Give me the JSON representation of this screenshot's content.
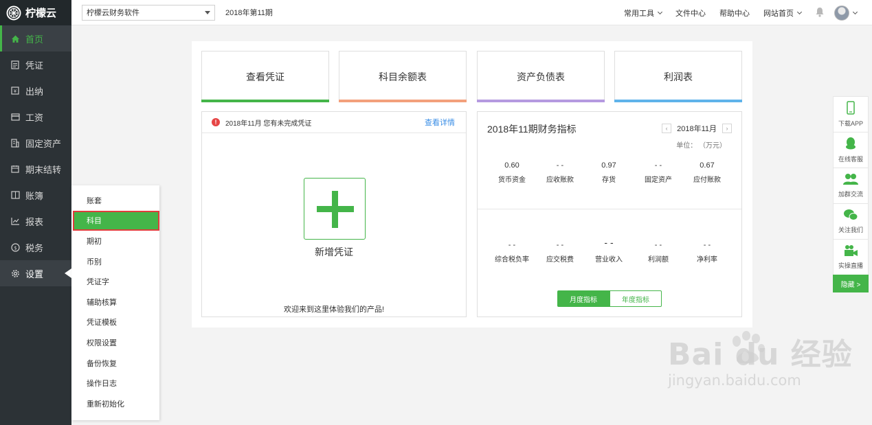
{
  "app": {
    "name": "柠檬云"
  },
  "sidebar": {
    "items": [
      {
        "label": "首页",
        "icon": "home-icon"
      },
      {
        "label": "凭证",
        "icon": "document-icon"
      },
      {
        "label": "出纳",
        "icon": "cash-icon"
      },
      {
        "label": "工资",
        "icon": "card-icon"
      },
      {
        "label": "固定资产",
        "icon": "building-icon"
      },
      {
        "label": "期末结转",
        "icon": "calendar-icon"
      },
      {
        "label": "账簿",
        "icon": "book-icon"
      },
      {
        "label": "报表",
        "icon": "chart-icon"
      },
      {
        "label": "税务",
        "icon": "tax-icon"
      },
      {
        "label": "设置",
        "icon": "gear-icon"
      }
    ]
  },
  "topbar": {
    "company": "柠檬云财务软件",
    "period": "2018年第11期",
    "links": {
      "tools": "常用工具",
      "files": "文件中心",
      "help": "帮助中心",
      "site": "网站首页"
    }
  },
  "quick_cards": [
    {
      "label": "查看凭证",
      "color": "#44b549"
    },
    {
      "label": "科目余额表",
      "color": "#f3a07c"
    },
    {
      "label": "资产负债表",
      "color": "#b59ae0"
    },
    {
      "label": "利润表",
      "color": "#5fb3ea"
    }
  ],
  "voucher_panel": {
    "notice": "2018年11月 您有未完成凭证",
    "detail_link": "查看详情",
    "add_label": "新增凭证",
    "welcome": "欢迎来到这里体验我们的产品!"
  },
  "finance_panel": {
    "title": "2018年11期财务指标",
    "date": "2018年11月",
    "unit": "单位： （万元）",
    "row1": [
      {
        "value": "0.60",
        "label": "货币资金"
      },
      {
        "value": "- -",
        "label": "应收账款"
      },
      {
        "value": "0.97",
        "label": "存货"
      },
      {
        "value": "- -",
        "label": "固定资产"
      },
      {
        "value": "0.67",
        "label": "应付账款"
      }
    ],
    "row2": [
      {
        "value": "- -",
        "label": "综合税负率"
      },
      {
        "value": "- -",
        "label": "应交税费"
      },
      {
        "value": "- -",
        "label": "营业收入"
      },
      {
        "value": "- -",
        "label": "利润额"
      },
      {
        "value": "- -",
        "label": "净利率"
      }
    ],
    "toggle": {
      "monthly": "月度指标",
      "yearly": "年度指标"
    }
  },
  "submenu": {
    "items": [
      "账套",
      "科目",
      "期初",
      "币别",
      "凭证字",
      "辅助核算",
      "凭证模板",
      "权限设置",
      "备份恢复",
      "操作日志",
      "重新初始化"
    ]
  },
  "floatbar": {
    "items": [
      {
        "label": "下载APP",
        "icon": "phone-icon"
      },
      {
        "label": "在线客服",
        "icon": "qq-icon"
      },
      {
        "label": "加群交流",
        "icon": "group-icon"
      },
      {
        "label": "关注我们",
        "icon": "wechat-icon"
      },
      {
        "label": "实操直播",
        "icon": "video-icon"
      }
    ],
    "hide": "隐藏 >"
  },
  "watermark": {
    "big": "Bai du 经验",
    "small": "jingyan.baidu.com"
  }
}
